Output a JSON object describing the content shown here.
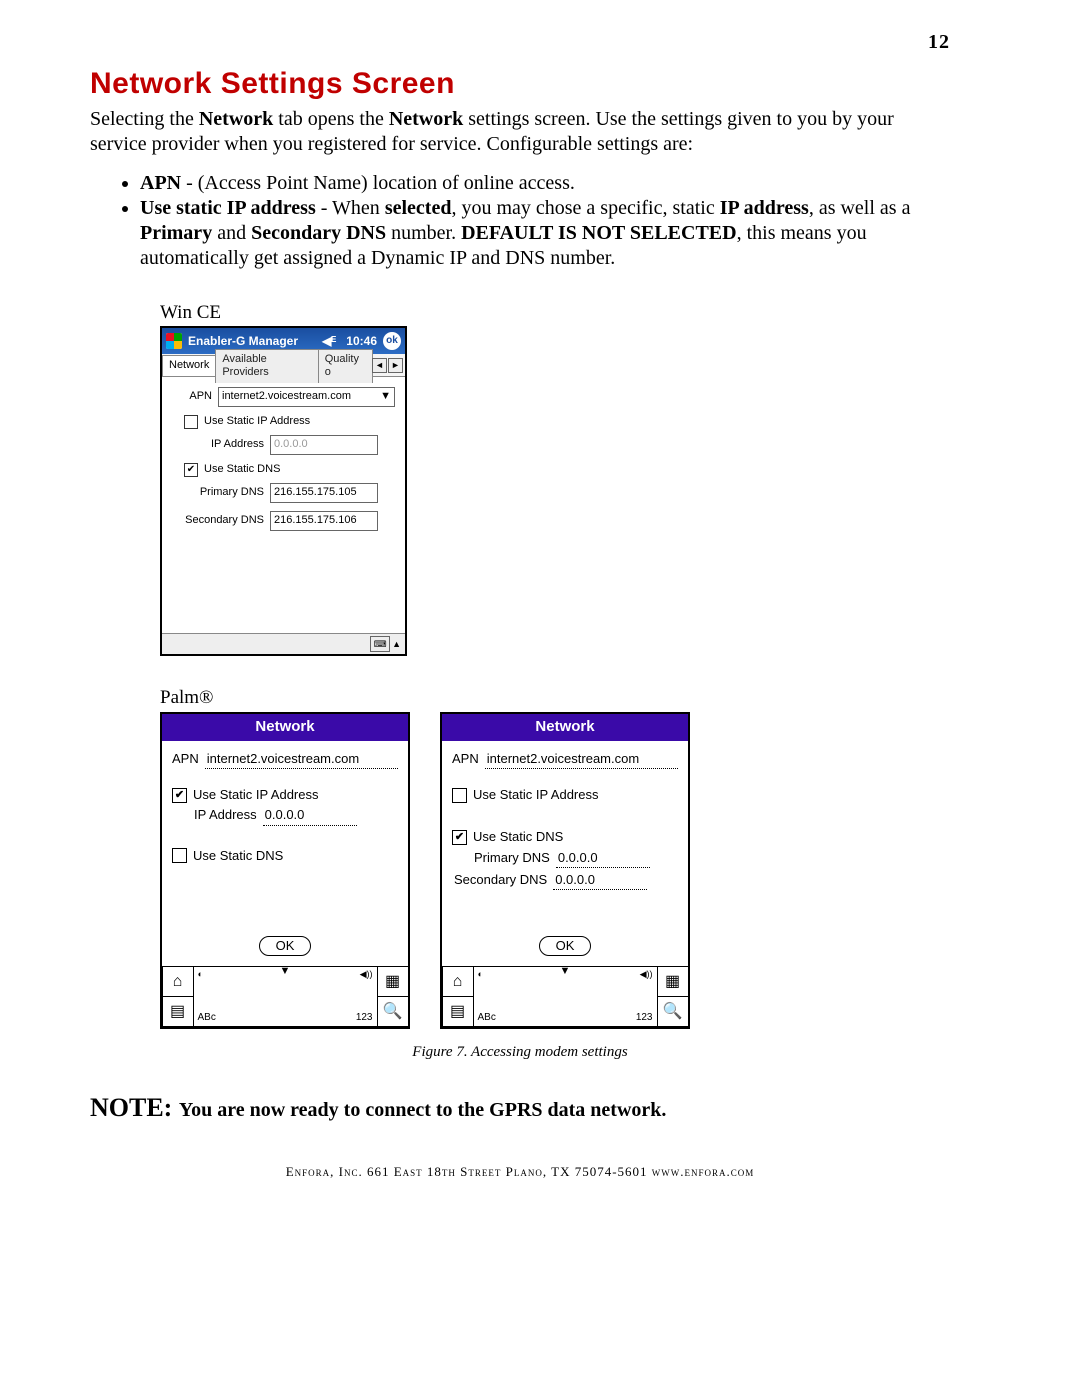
{
  "page_number": "12",
  "heading": "Network Settings Screen",
  "intro_pre": "Selecting the ",
  "intro_bold1": "Network",
  "intro_mid1": " tab opens the ",
  "intro_bold2": "Network",
  "intro_post": " settings screen. Use the settings given to you by your service provider when you registered for service. Configurable settings are:",
  "bullet_apn_b": "APN",
  "bullet_apn_t": " - (Access Point Name) location of online access.",
  "b2_t1": "Use static IP address",
  "b2_t2": " - When ",
  "b2_t3": "selected",
  "b2_t4": ", you may chose a specific, static ",
  "b2_t5": "IP address",
  "b2_t6": ", as well as a ",
  "b2_t7": "Primary",
  "b2_t8": " and ",
  "b2_t9": "Secondary DNS",
  "b2_t10": " number. ",
  "b2_t11": "DEFAULT  IS NOT SELECTED",
  "b2_t12": ", this means you automatically get assigned a Dynamic IP and DNS number.",
  "label_wince": "Win CE",
  "label_palm": "Palm®",
  "wince": {
    "app_title": "Enabler-G Manager",
    "clock": "10:46",
    "ok": "ok",
    "tabs": [
      "Network",
      "Available Providers",
      "Quality o"
    ],
    "apn_label": "APN",
    "apn_value": "internet2.voicestream.com",
    "use_static_ip": "Use Static IP Address",
    "ip_label": "IP Address",
    "ip_value": "0.0.0.0",
    "use_static_dns": "Use Static DNS",
    "primary_dns_label": "Primary DNS",
    "primary_dns_value": "216.155.175.105",
    "secondary_dns_label": "Secondary DNS",
    "secondary_dns_value": "216.155.175.106"
  },
  "palm": {
    "title": "Network",
    "apn_label": "APN",
    "apn_value": "internet2.voicestream.com",
    "use_static_ip": "Use Static IP Address",
    "ip_label": "IP Address",
    "ip_value": "0.0.0.0",
    "use_static_dns": "Use Static DNS",
    "primary_dns_label": "Primary DNS",
    "primary_dns_value": "0.0.0.0",
    "secondary_dns_label": "Secondary DNS",
    "secondary_dns_value": "0.0.0.0",
    "ok": "OK",
    "graffiti_abc": "ABc",
    "graffiti_123": "123"
  },
  "figure_caption": "Figure 7.  Accessing modem settings",
  "note_b1": "NOTE: ",
  "note_b2": "You are now ready to connect to the GPRS data network.",
  "footer": "Enfora, Inc.  661 East 18th Street  Plano, TX  75074-5601  www.enfora.com"
}
